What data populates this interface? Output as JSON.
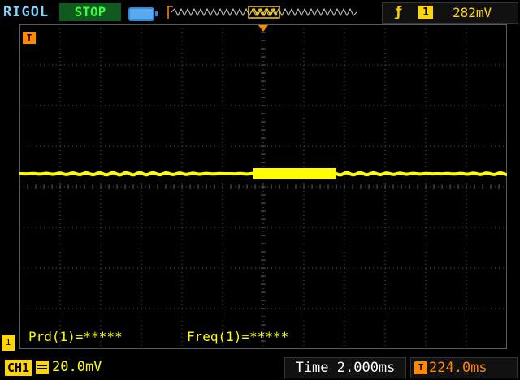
{
  "header": {
    "brand": "RIGOL",
    "run_state": "STOP",
    "trigger_source": "1",
    "trigger_level": "282mV"
  },
  "markers": {
    "trigger_marker": "T",
    "ch1_ground": "1"
  },
  "measurements": {
    "period": "Prd(1)=*****",
    "frequency": "Freq(1)=*****"
  },
  "footer": {
    "channel": "CH1",
    "ch1_scale": "20.0mV",
    "timebase": "Time 2.000ms",
    "trigger_offset_icon": "T",
    "trigger_offset": "224.0ms"
  },
  "colors": {
    "trace": "#ffff00",
    "grid": "#5a5a5a",
    "accent_orange": "#ff8a00",
    "stop_bg": "#0f5a1e",
    "stop_text": "#3cff3c"
  },
  "icons": {
    "trigger_edge": "rising-edge-icon",
    "battery": "battery-icon",
    "coupling": "dc-coupling-icon"
  }
}
